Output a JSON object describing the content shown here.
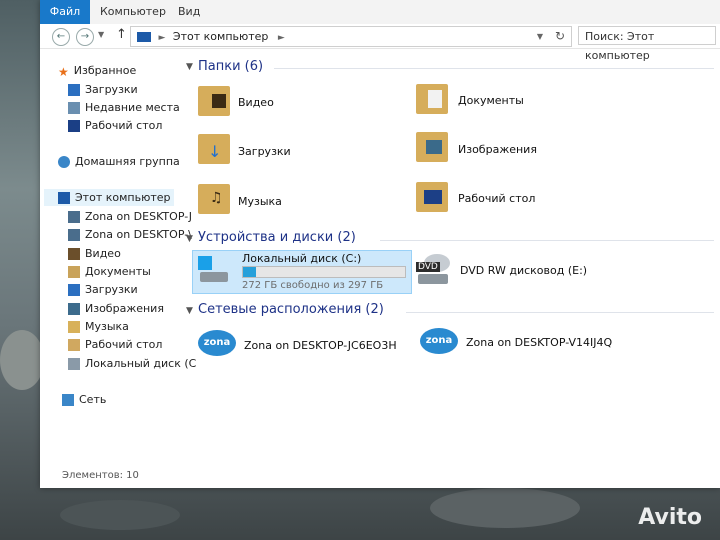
{
  "menu": {
    "file": "Файл",
    "computer": "Компьютер",
    "view": "Вид"
  },
  "address": {
    "path": "Этот компьютер",
    "search_placeholder": "Поиск: Этот компьютер"
  },
  "sidebar": {
    "favorites": "Избранное",
    "fav_items": [
      "Загрузки",
      "Недавние места",
      "Рабочий стол"
    ],
    "homegroup": "Домашняя группа",
    "this_pc": "Этот компьютер",
    "pc_items": [
      "Zona on DESKTOP-J",
      "Zona on DESKTOP-\\",
      "Видео",
      "Документы",
      "Загрузки",
      "Изображения",
      "Музыка",
      "Рабочий стол",
      "Локальный диск (C"
    ],
    "network": "Сеть"
  },
  "groups": {
    "folders": "Папки (6)",
    "devices": "Устройства и диски (2)",
    "network": "Сетевые расположения (2)"
  },
  "folders": [
    "Видео",
    "Документы",
    "Загрузки",
    "Изображения",
    "Музыка",
    "Рабочий стол"
  ],
  "drives": {
    "c_name": "Локальный диск (C:)",
    "c_free": "272 ГБ свободно из 297 ГБ",
    "c_used_fraction": 0.08,
    "dvd_name": "DVD RW дисковод (E:)",
    "dvd_badge": "DVD"
  },
  "network_items": [
    "Zona on DESKTOP-JC6EO3H",
    "Zona on DESKTOP-V14IJ4Q"
  ],
  "zona_label": "zona",
  "status": "Элементов: 10",
  "watermark": "Avito",
  "colors": {
    "accent": "#1979ca",
    "selection": "#cde8fb",
    "group_text": "#1e3287",
    "bar_fill": "#26a0da"
  }
}
